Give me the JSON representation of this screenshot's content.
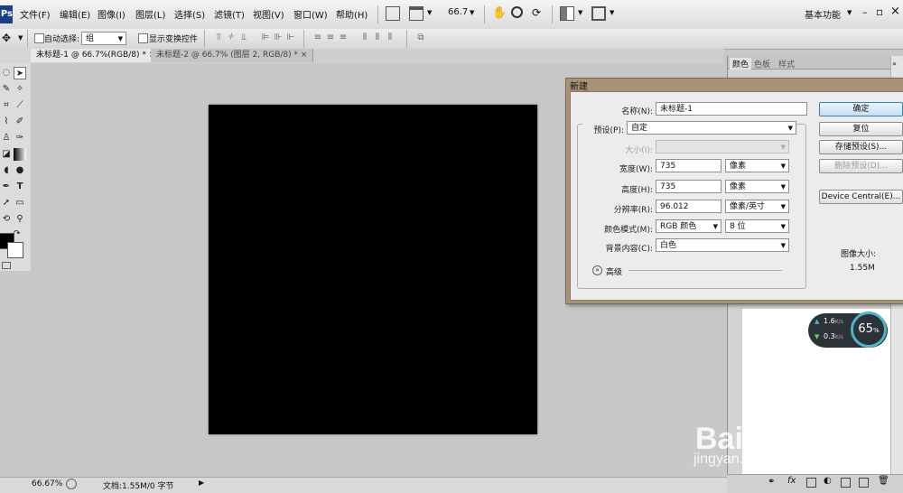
{
  "app": {
    "logo": "Ps"
  },
  "menubar": {
    "items": [
      "文件(F)",
      "编辑(E)",
      "图像(I)",
      "图层(L)",
      "选择(S)",
      "滤镜(T)",
      "视图(V)",
      "窗口(W)",
      "帮助(H)"
    ],
    "zoom": "66.7",
    "workspace": "基本功能",
    "window_controls": {
      "minimize": "–",
      "restore": "▫",
      "close": "×"
    }
  },
  "options": {
    "auto_select_label": "自动选择:",
    "auto_select_value": "组",
    "show_transform_label": "显示变换控件"
  },
  "tabs": [
    {
      "label": "未标题-1 @ 66.7%(RGB/8) *",
      "close": "×",
      "active": true
    },
    {
      "label": "未标题-2 @ 66.7% (图层 2, RGB/8) *",
      "close": "×",
      "active": false
    }
  ],
  "statusbar": {
    "zoom": "66.67%",
    "doc_info": "文档:1.55M/0 字节"
  },
  "panels": {
    "tabs": [
      "颜色",
      "色板",
      "样式"
    ]
  },
  "dialog": {
    "title": "新建",
    "name_label": "名称(N):",
    "name_value": "未标题-1",
    "preset_label": "预设(P):",
    "preset_value": "自定",
    "size_label": "大小(I):",
    "size_value": "",
    "width_label": "宽度(W):",
    "width_value": "735",
    "width_unit": "像素",
    "height_label": "高度(H):",
    "height_value": "735",
    "height_unit": "像素",
    "resolution_label": "分辨率(R):",
    "resolution_value": "96.012",
    "resolution_unit": "像素/英寸",
    "color_mode_label": "颜色模式(M):",
    "color_mode_value": "RGB 颜色",
    "bit_depth_value": "8 位",
    "background_label": "背景内容(C):",
    "background_value": "白色",
    "advanced_label": "高级",
    "buttons": {
      "ok": "确定",
      "reset": "复位",
      "save_preset": "存储预设(S)...",
      "delete_preset": "删除预设(D)...",
      "device_central": "Device Central(E)..."
    },
    "image_size_label": "图像大小:",
    "image_size_value": "1.55M"
  },
  "speed_widget": {
    "up": "1.6",
    "down": "0.3",
    "unit": "K/s",
    "percent": "65",
    "percent_sign": "%"
  },
  "watermark": {
    "brand": "Bai du 经验",
    "url": "jingyan.baidu.com"
  },
  "colors": {
    "canvas": "#000000",
    "workspace": "#c8c8c8",
    "dialog_frame": "#a89278",
    "ring": "#4fb4c8"
  }
}
